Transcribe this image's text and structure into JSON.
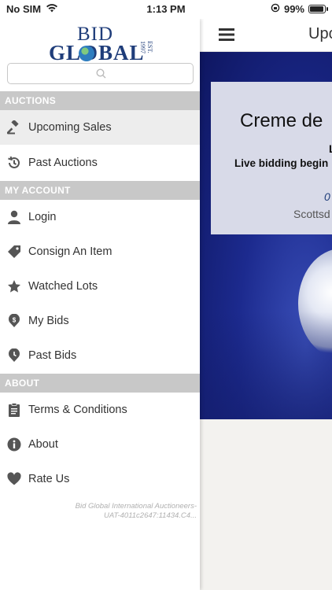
{
  "status_bar": {
    "carrier": "No SIM",
    "time": "1:13 PM",
    "battery": "99%",
    "battery_level": 0.99
  },
  "logo": {
    "line1": "BID",
    "line2": "GLOBAL",
    "est": "EST. 1997"
  },
  "search": {
    "placeholder": ""
  },
  "sections": {
    "auctions": "AUCTIONS",
    "my_account": "MY ACCOUNT",
    "about": "ABOUT"
  },
  "menu": {
    "upcoming_sales": "Upcoming Sales",
    "past_auctions": "Past Auctions",
    "login": "Login",
    "consign": "Consign An Item",
    "watched_lots": "Watched Lots",
    "my_bids": "My Bids",
    "past_bids": "Past Bids",
    "terms": "Terms & Conditions",
    "about": "About",
    "rate_us": "Rate Us"
  },
  "footer": {
    "line1": "Bid Global International Auctioneers-",
    "line2": "UAT-4011c2647:11434.C4..."
  },
  "main": {
    "title": "Upco",
    "card_title": "Creme de",
    "card_line1": "L",
    "card_line2": "Live bidding begin",
    "card_date": "0",
    "card_location": "Scottsd"
  },
  "colors": {
    "brand": "#1f3d7a",
    "section_bg": "#c8c8c8",
    "active_bg": "#ededed"
  }
}
